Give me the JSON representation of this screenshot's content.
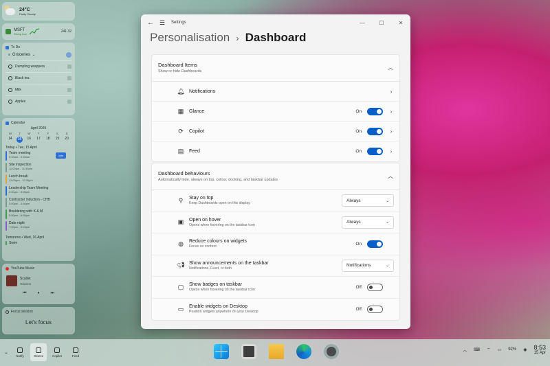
{
  "widgets": {
    "weather": {
      "temp": "24°C",
      "desc": "Partly Cloudy"
    },
    "stock": {
      "symbol": "MSFT",
      "sub": "Rising fast",
      "price": "241.32"
    },
    "todo": {
      "title": "To Do",
      "list": "Groceries",
      "items": [
        "Dumpling wrappers",
        "Black tea",
        "Milk",
        "Apples"
      ]
    },
    "calendar": {
      "title": "Calendar",
      "month": "April 2025",
      "day_names": [
        "M",
        "T",
        "W",
        "T",
        "F",
        "S",
        "S"
      ],
      "days": [
        "14",
        "15",
        "16",
        "17",
        "18",
        "19",
        "20"
      ],
      "today_label": "Today • Tue, 15 April",
      "join_label": "Join",
      "events": [
        {
          "title": "Team meeting",
          "time": "9:00am - 9:30am",
          "color": "#2e6fd6"
        },
        {
          "title": "Site inspection",
          "time": "11:00am - 11:30am",
          "color": "#7b9a8b"
        },
        {
          "title": "Lunch break",
          "time": "12:00pm - 12:30pm",
          "color": "#d9a441"
        },
        {
          "title": "Leadership Team Meeting",
          "time": "2:00pm - 3:00pm",
          "color": "#2e6fd6"
        },
        {
          "title": "Contractor induction - CHB",
          "time": "3:00pm - 3:30pm",
          "color": "#7b9a8b"
        },
        {
          "title": "Bouldering with K & M",
          "time": "5:00pm - 6:30pm",
          "color": "#3c9a4a"
        },
        {
          "title": "Date night",
          "time": "7:00pm - 9:00pm",
          "color": "#8a5cc9"
        }
      ],
      "tomorrow_label": "Tomorrow • Wed, 16 April",
      "tomorrow_event": "Swim"
    },
    "music": {
      "app": "YouTube Music",
      "song": "Scarlet",
      "artist": "Taiwans"
    },
    "focus": {
      "title": "Focus session",
      "cta": "Let's focus"
    }
  },
  "window": {
    "title": "Settings",
    "breadcrumb_parent": "Personalisation",
    "breadcrumb_sep": "›",
    "breadcrumb_current": "Dashboard",
    "items_section": {
      "title": "Dashboard Items",
      "desc": "Show or hide Dashboards",
      "rows": [
        {
          "label": "Notifications",
          "state": "",
          "toggle": ""
        },
        {
          "label": "Glance",
          "state": "On",
          "toggle": "on"
        },
        {
          "label": "Copilot",
          "state": "On",
          "toggle": "on"
        },
        {
          "label": "Feed",
          "state": "On",
          "toggle": "on"
        }
      ]
    },
    "behaviours_section": {
      "title": "Dashboard behaviours",
      "desc": "Automatically hide, always on top, colour, docking, and taskbar updates",
      "rows": [
        {
          "label": "Stay on top",
          "desc": "Keep Dashboards open on this display",
          "value": "Always"
        },
        {
          "label": "Open on hover",
          "desc": "Opens when hovering on the taskbar icon",
          "value": "Always"
        },
        {
          "label": "Reduce colours on widgets",
          "desc": "Focus on content",
          "state": "On"
        },
        {
          "label": "Show announcements on the taskbar",
          "desc": "Notifications, Feed, or both",
          "value": "Notifications"
        },
        {
          "label": "Show badges on taskbar",
          "desc": "Opens when hovering on the taskbar icon",
          "state": "Off"
        },
        {
          "label": "Enable widgets on Desktop",
          "desc": "Position widgets anywhere on your Desktop",
          "state": "Off"
        }
      ]
    }
  },
  "taskbar": {
    "widgets": [
      {
        "label": "Notify"
      },
      {
        "label": "Glance"
      },
      {
        "label": "Copilot"
      },
      {
        "label": "Feed"
      }
    ],
    "battery": "92%",
    "time": "8:53",
    "date": "15 Apr"
  }
}
